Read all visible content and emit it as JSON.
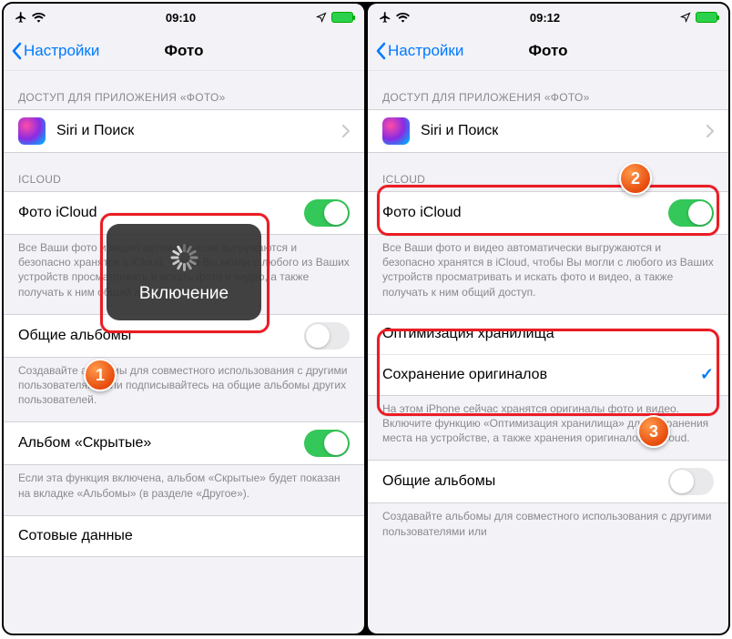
{
  "left": {
    "status": {
      "time": "09:10"
    },
    "nav": {
      "back": "Настройки",
      "title": "Фото"
    },
    "section_access": "ДОСТУП ДЛЯ ПРИЛОЖЕНИЯ «ФОТО»",
    "siri_label": "Siri и Поиск",
    "section_icloud": "ICLOUD",
    "icloud_photos": "Фото iCloud",
    "icloud_footer": "Все Ваши фото и видео автоматически выгружаются и безопасно хранятся в iCloud, чтобы Вы могли с любого из Ваших устройств просматривать и искать фото и видео, а также получать к ним общий доступ.",
    "shared_albums": "Общие альбомы",
    "shared_footer": "Создавайте альбомы для совместного использования с другими пользователями или подписывайтесь на общие альбомы других пользователей.",
    "hidden_album": "Альбом «Скрытые»",
    "hidden_footer": "Если эта функция включена, альбом «Скрытые» будет показан на вкладке «Альбомы» (в разделе «Другое»).",
    "cell_bottom": "Сотовые данные",
    "hud_text": "Включение",
    "badge": "1"
  },
  "right": {
    "status": {
      "time": "09:12"
    },
    "nav": {
      "back": "Настройки",
      "title": "Фото"
    },
    "section_access": "ДОСТУП ДЛЯ ПРИЛОЖЕНИЯ «ФОТО»",
    "siri_label": "Siri и Поиск",
    "section_icloud": "ICLOUD",
    "icloud_photos": "Фото iCloud",
    "icloud_footer": "Все Ваши фото и видео автоматически выгружаются и безопасно хранятся в iCloud, чтобы Вы могли с любого из Ваших устройств просматривать и искать фото и видео, а также получать к ним общий доступ.",
    "optimize": "Оптимизация хранилища",
    "keep_orig": "Сохранение оригиналов",
    "storage_footer": "На этом iPhone сейчас хранятся оригиналы фото и видео. Включите функцию «Оптимизация хранилища» для сохранения места на устройстве, а также хранения оригиналов в iCloud.",
    "shared_albums": "Общие альбомы",
    "shared_footer": "Создавайте альбомы для совместного использования с другими пользователями или",
    "badge2": "2",
    "badge3": "3"
  }
}
